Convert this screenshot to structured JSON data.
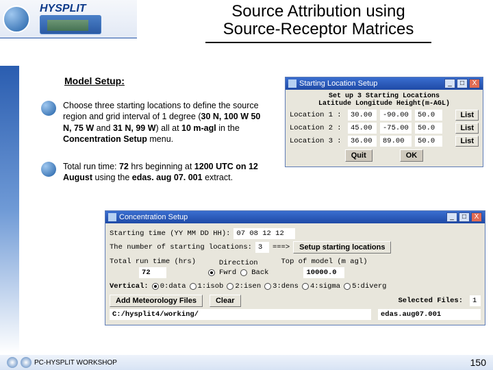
{
  "header": {
    "logo_text": "HYSPLIT",
    "title_l1": "Source Attribution using",
    "title_l2": "Source-Receptor Matrices"
  },
  "subheading": "Model Setup:",
  "bullets": [
    {
      "frags": [
        {
          "t": "Choose three starting locations to define the source region and grid interval of 1 degree (",
          "b": false
        },
        {
          "t": "30 N, 100 W",
          "b": true
        },
        {
          "t": "  ",
          "b": false
        },
        {
          "t": "50 N, 75 W",
          "b": true
        },
        {
          "t": " and ",
          "b": false
        },
        {
          "t": "31 N, 99 W",
          "b": true
        },
        {
          "t": ") all at ",
          "b": false
        },
        {
          "t": "10 m-agl",
          "b": true
        },
        {
          "t": " in the ",
          "b": false
        },
        {
          "t": "Concentration Setup",
          "b": true
        },
        {
          "t": " menu.",
          "b": false
        }
      ]
    },
    {
      "frags": [
        {
          "t": "Total run time: ",
          "b": false
        },
        {
          "t": "72",
          "b": true
        },
        {
          "t": " hrs beginning at ",
          "b": false
        },
        {
          "t": "1200 UTC on 12 August",
          "b": true
        },
        {
          "t": " using the ",
          "b": false
        },
        {
          "t": "edas. aug 07. 001",
          "b": true
        },
        {
          "t": " extract.",
          "b": false
        }
      ]
    }
  ],
  "win1": {
    "title": "Starting Location Setup",
    "head1": "Set up 3 Starting Locations",
    "head2": "Latitude Longitude Height(m-AGL)",
    "rows": [
      {
        "label": "Location 1 :",
        "lat": "30.00",
        "lon": "-90.00",
        "ht": "50.0"
      },
      {
        "label": "Location 2 :",
        "lat": "45.00",
        "lon": "-75.00",
        "ht": "50.0"
      },
      {
        "label": "Location 3 :",
        "lat": "36.00",
        "lon": "89.00",
        "ht": "50.0"
      }
    ],
    "list_label": "List",
    "quit": "Quit",
    "ok": "OK"
  },
  "win2": {
    "title": "Concentration Setup",
    "start_label": "Starting time (YY MM DD HH):",
    "start_value": "07 08 12 12",
    "numloc_label": "The number of starting locations:",
    "numloc_value": "3",
    "arrow": "===>",
    "setup_btn": "Setup starting locations",
    "runtime_label": "Total run time (hrs)",
    "runtime_value": "72",
    "direction_label": "Direction",
    "fwd": "Fwrd",
    "back": "Back",
    "top_label": "Top of model (m agl)",
    "top_value": "10000.0",
    "vertical_label": "Vertical:",
    "vopts": [
      "0:data",
      "1:isob",
      "2:isen",
      "3:dens",
      "4:sigma",
      "5:diverg"
    ],
    "add_btn": "Add Meteorology Files",
    "clear_btn": "Clear",
    "sel_label": "Selected Files:",
    "sel_value": "1",
    "path": "C:/hysplit4/working/",
    "extract": "edas.aug07.001"
  },
  "footer": {
    "text": "PC-HYSPLIT WORKSHOP",
    "page": "150"
  }
}
